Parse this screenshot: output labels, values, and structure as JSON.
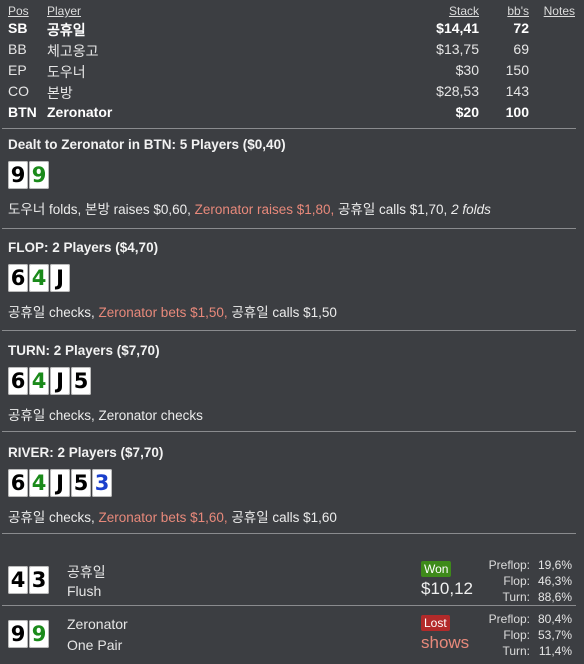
{
  "columns": {
    "pos": "Pos",
    "player": "Player",
    "stack": "Stack",
    "bbs": "bb's",
    "notes": "Notes"
  },
  "players": [
    {
      "pos": "SB",
      "name": "공휴일",
      "stack": "$14,41",
      "bbs": "72",
      "bold": true
    },
    {
      "pos": "BB",
      "name": "체고옹고",
      "stack": "$13,75",
      "bbs": "69",
      "bold": false
    },
    {
      "pos": "EP",
      "name": "도우너",
      "stack": "$30",
      "bbs": "150",
      "bold": false
    },
    {
      "pos": "CO",
      "name": "본방",
      "stack": "$28,53",
      "bbs": "143",
      "bold": false
    },
    {
      "pos": "BTN",
      "name": "Zeronator",
      "stack": "$20",
      "bbs": "100",
      "bold": true
    }
  ],
  "streets": [
    {
      "title": "Dealt to Zeronator in BTN: 5 Players ($0,40)",
      "cards": [
        {
          "rank": "9",
          "color": "black"
        },
        {
          "rank": "9",
          "color": "green"
        }
      ],
      "actions": [
        {
          "text": "도우너 folds, 본방 raises $0,60, ",
          "style": "normal"
        },
        {
          "text": "Zeronator raises $1,80, ",
          "style": "hero"
        },
        {
          "text": "공휴일 calls $1,70, ",
          "style": "normal"
        },
        {
          "text": "2 folds",
          "style": "italic"
        }
      ]
    },
    {
      "title": "FLOP: 2 Players ($4,70)",
      "cards": [
        {
          "rank": "6",
          "color": "black"
        },
        {
          "rank": "4",
          "color": "green"
        },
        {
          "rank": "J",
          "color": "black"
        }
      ],
      "actions": [
        {
          "text": "공휴일 checks, ",
          "style": "normal"
        },
        {
          "text": "Zeronator bets $1,50, ",
          "style": "hero"
        },
        {
          "text": "공휴일 calls $1,50",
          "style": "normal"
        }
      ]
    },
    {
      "title": "TURN: 2 Players ($7,70)",
      "cards": [
        {
          "rank": "6",
          "color": "black"
        },
        {
          "rank": "4",
          "color": "green"
        },
        {
          "rank": "J",
          "color": "black"
        },
        {
          "rank": "5",
          "color": "black"
        }
      ],
      "actions": [
        {
          "text": "공휴일 checks, Zeronator checks",
          "style": "normal"
        }
      ]
    },
    {
      "title": "RIVER: 2 Players ($7,70)",
      "cards": [
        {
          "rank": "6",
          "color": "black"
        },
        {
          "rank": "4",
          "color": "green"
        },
        {
          "rank": "J",
          "color": "black"
        },
        {
          "rank": "5",
          "color": "black"
        },
        {
          "rank": "3",
          "color": "blue"
        }
      ],
      "actions": [
        {
          "text": "공휴일 checks, ",
          "style": "normal"
        },
        {
          "text": "Zeronator bets $1,60, ",
          "style": "hero"
        },
        {
          "text": "공휴일 calls $1,60",
          "style": "normal"
        }
      ]
    }
  ],
  "results": [
    {
      "name": "공휴일",
      "hand": "Flush",
      "badge": "Won",
      "amount": "$10,12",
      "outcome": "won",
      "cards": [
        {
          "rank": "4",
          "color": "black"
        },
        {
          "rank": "3",
          "color": "black"
        }
      ],
      "equity": [
        {
          "label": "Preflop:",
          "value": "19,6%"
        },
        {
          "label": "Flop:",
          "value": "46,3%"
        },
        {
          "label": "Turn:",
          "value": "88,6%"
        }
      ]
    },
    {
      "name": "Zeronator",
      "hand": "One Pair",
      "badge": "Lost",
      "amount": "shows",
      "outcome": "lost",
      "cards": [
        {
          "rank": "9",
          "color": "black"
        },
        {
          "rank": "9",
          "color": "green"
        }
      ],
      "equity": [
        {
          "label": "Preflop:",
          "value": "80,4%"
        },
        {
          "label": "Flop:",
          "value": "53,7%"
        },
        {
          "label": "Turn:",
          "value": "11,4%"
        }
      ]
    }
  ],
  "colors": {
    "background": "#3c3e42",
    "hero_action": "#e8897b",
    "won": "#3e8a1a",
    "lost": "#b22a2a",
    "card_green": "#1a8a1a",
    "card_blue": "#1a3fcc"
  }
}
